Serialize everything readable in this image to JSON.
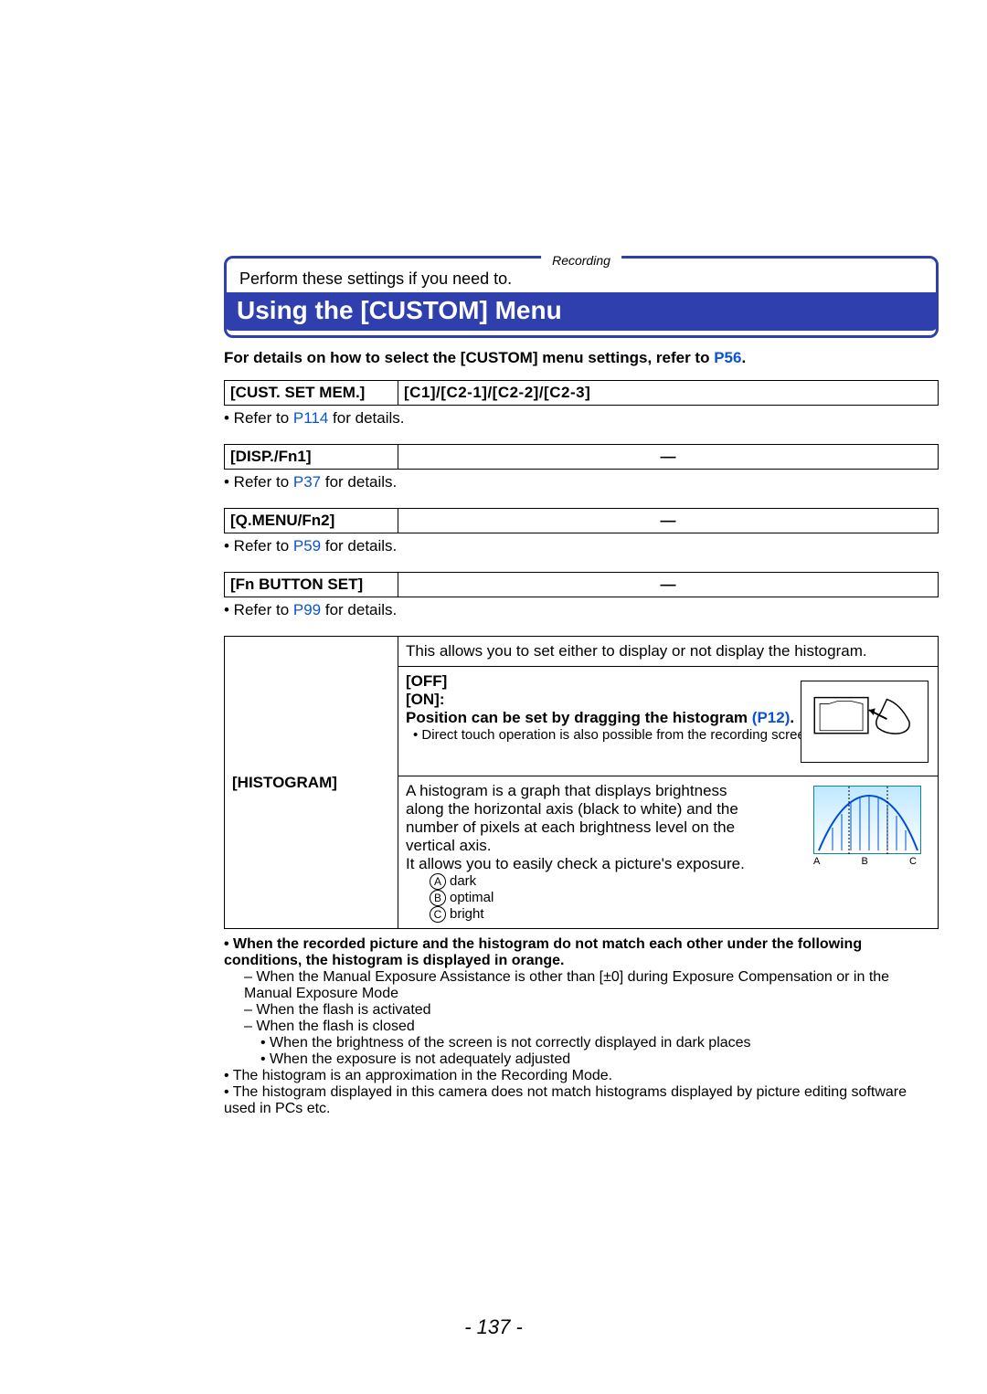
{
  "header": {
    "tab": "Recording",
    "perform": "Perform these settings if you need to.",
    "title": "Using the [CUSTOM] Menu"
  },
  "details_prefix": "For details on how to select the [CUSTOM] menu settings, refer to ",
  "details_link": "P56",
  "details_suffix": ".",
  "settings": {
    "custsetmem": {
      "label": "[CUST. SET MEM.]",
      "value": "[C1]/[C2-1]/[C2-2]/[C2-3]",
      "refer_pre": "• Refer to ",
      "refer_link": "P114",
      "refer_post": " for details."
    },
    "dispfn1": {
      "label": "[DISP./Fn1]",
      "value": "—",
      "refer_pre": "• Refer to ",
      "refer_link": "P37",
      "refer_post": " for details."
    },
    "qmenu": {
      "label": "[Q.MENU/Fn2]",
      "value": "—",
      "refer_pre": "• Refer to ",
      "refer_link": "P59",
      "refer_post": " for details."
    },
    "fnbutton": {
      "label": "[Fn BUTTON SET]",
      "value": "—",
      "refer_pre": "• Refer to ",
      "refer_link": "P99",
      "refer_post": " for details."
    }
  },
  "histogram": {
    "label": "[HISTOGRAM]",
    "row1": "This allows you to set either to display or not display the histogram.",
    "off": "[OFF]",
    "on": "[ON]:",
    "pos_pre": "Position can be set by dragging the histogram ",
    "pos_link": "(P12)",
    "pos_post": ".",
    "touch_note": "• Direct touch operation is also possible from the recording screen.",
    "row3a": "A histogram is a graph that displays brightness along the horizontal axis (black to white) and the number of pixels at each brightness level on the vertical axis.",
    "row3b": "It allows you to easily check a picture's exposure.",
    "list_a": "dark",
    "list_b": "optimal",
    "list_c": "bright",
    "label_a": "A",
    "label_b": "B",
    "label_c": "C"
  },
  "notes": {
    "n1a": "• When the recorded picture and the histogram do not match each other under the following conditions, the histogram is displayed in orange.",
    "n1_1": "– When the Manual Exposure Assistance is other than [±0] during Exposure Compensation or in the Manual Exposure Mode",
    "n1_2": "– When the flash is activated",
    "n1_3": "– When the flash is closed",
    "n1_3a": "• When the brightness of the screen is not correctly displayed in dark places",
    "n1_3b": "• When the exposure is not adequately adjusted",
    "n2": "• The histogram is an approximation in the Recording Mode.",
    "n3": "• The histogram displayed in this camera does not match histograms displayed by picture editing software used in PCs etc."
  },
  "page_number": "- 137 -"
}
